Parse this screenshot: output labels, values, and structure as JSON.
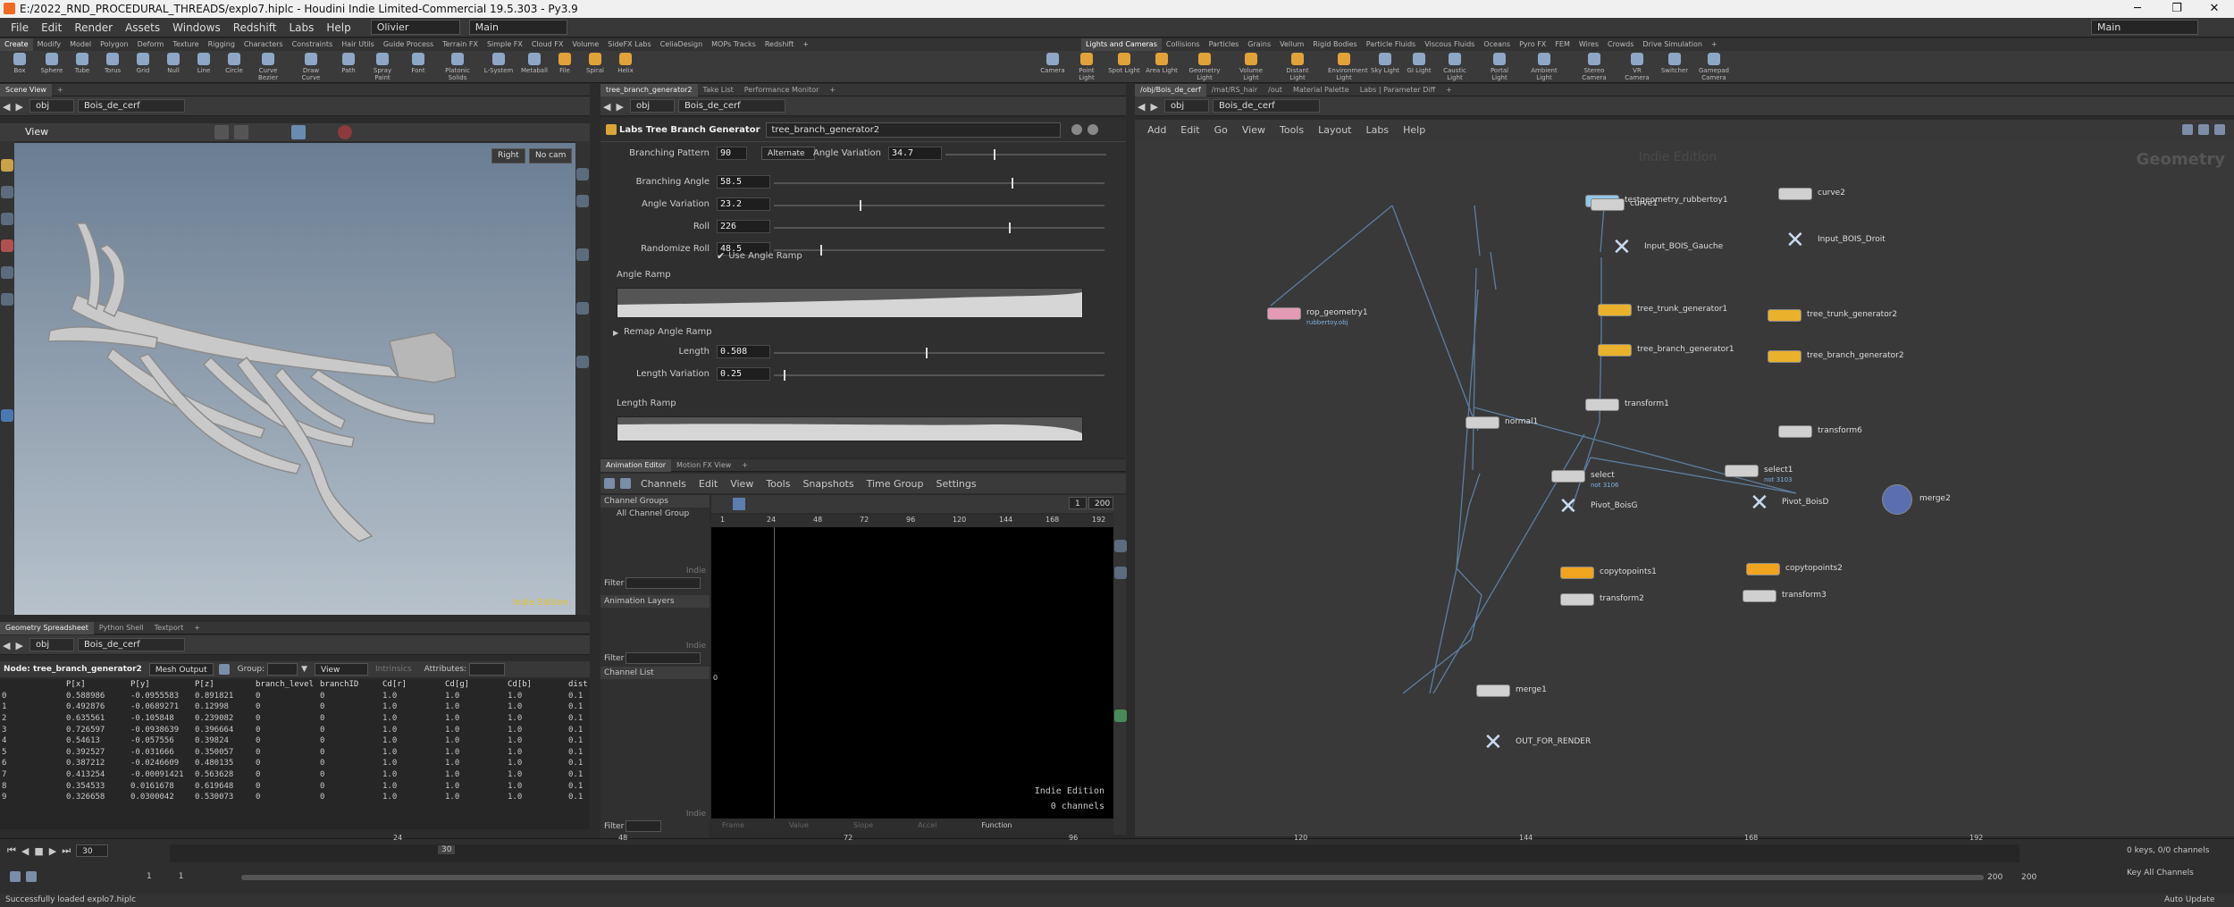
{
  "window": {
    "title": "E:/2022_RND_PROCEDURAL_THREADS/explo7.hiplc - Houdini Indie Limited-Commercial 19.5.303 - Py3.9"
  },
  "menubar": {
    "items": [
      "File",
      "Edit",
      "Render",
      "Assets",
      "Windows",
      "Redshift",
      "Labs",
      "Help"
    ],
    "desktop": "Olivier",
    "main": "Main",
    "right_desktop": "Main"
  },
  "shelf_tabs_left": [
    "Create",
    "Modify",
    "Model",
    "Polygon",
    "Deform",
    "Texture",
    "Rigging",
    "Characters",
    "Constraints",
    "Hair Utils",
    "Guide Process",
    "Terrain FX",
    "Simple FX",
    "Cloud FX",
    "Volume",
    "SideFX Labs",
    "CeliaDesign",
    "MOPs Tracks",
    "Redshift"
  ],
  "shelf_tabs_right": [
    "Lights and Cameras",
    "Collisions",
    "Particles",
    "Grains",
    "Vellum",
    "Rigid Bodies",
    "Particle Fluids",
    "Viscous Fluids",
    "Oceans",
    "Pyro FX",
    "FEM",
    "Wires",
    "Crowds",
    "Drive Simulation"
  ],
  "tools_left": [
    "Box",
    "Sphere",
    "Tube",
    "Torus",
    "Grid",
    "Null",
    "Line",
    "Circle",
    "Curve Bezier",
    "Draw Curve",
    "Path",
    "Spray Paint",
    "Font",
    "Platonic Solids",
    "L-System",
    "Metaball",
    "File",
    "Spiral",
    "Helix"
  ],
  "tools_right": [
    "Camera",
    "Point Light",
    "Spot Light",
    "Area Light",
    "Geometry Light",
    "Volume Light",
    "Distant Light",
    "Environment Light",
    "Sky Light",
    "GI Light",
    "Caustic Light",
    "Portal Light",
    "Ambient Light",
    "Stereo Camera",
    "VR Camera",
    "Switcher",
    "Gamepad Camera"
  ],
  "scene_view": {
    "tab": "Scene View",
    "path_obj": "obj",
    "path_node": "Bois_de_cerf",
    "view_label": "View",
    "cam": "Right",
    "no_cam": "No cam",
    "watermark": "Indie Edition"
  },
  "spreadsheet": {
    "tabs": [
      "Geometry Spreadsheet",
      "Python Shell",
      "Textport"
    ],
    "path_obj": "obj",
    "path_node": "Bois_de_cerf",
    "node_label": "Node: tree_branch_generator2",
    "mode": "Mesh Output",
    "group_label": "Group:",
    "view": "View",
    "intrinsics": "Intrinsics",
    "attributes": "Attributes:",
    "columns": [
      "",
      "P[x]",
      "P[y]",
      "P[z]",
      "branch_level",
      "branchID",
      "Cd[r]",
      "Cd[g]",
      "Cd[b]",
      "dist"
    ],
    "rows": [
      [
        "0",
        "0.588986",
        "-0.0955583",
        "0.891821",
        "0",
        "0",
        "1.0",
        "1.0",
        "1.0",
        "0.1"
      ],
      [
        "1",
        "0.492876",
        "-0.0689271",
        "0.12998",
        "0",
        "0",
        "1.0",
        "1.0",
        "1.0",
        "0.1"
      ],
      [
        "2",
        "0.635561",
        "-0.105848",
        "0.239082",
        "0",
        "0",
        "1.0",
        "1.0",
        "1.0",
        "0.1"
      ],
      [
        "3",
        "0.726597",
        "-0.0938639",
        "0.396664",
        "0",
        "0",
        "1.0",
        "1.0",
        "1.0",
        "0.1"
      ],
      [
        "4",
        "0.54613",
        "-0.057556",
        "0.39824",
        "0",
        "0",
        "1.0",
        "1.0",
        "1.0",
        "0.1"
      ],
      [
        "5",
        "0.392527",
        "-0.031666",
        "0.350057",
        "0",
        "0",
        "1.0",
        "1.0",
        "1.0",
        "0.1"
      ],
      [
        "6",
        "0.387212",
        "-0.0246609",
        "0.480135",
        "0",
        "0",
        "1.0",
        "1.0",
        "1.0",
        "0.1"
      ],
      [
        "7",
        "0.413254",
        "-0.00091421",
        "0.563628",
        "0",
        "0",
        "1.0",
        "1.0",
        "1.0",
        "0.1"
      ],
      [
        "8",
        "0.354533",
        "0.0161678",
        "0.619648",
        "0",
        "0",
        "1.0",
        "1.0",
        "1.0",
        "0.1"
      ],
      [
        "9",
        "0.326658",
        "0.0300042",
        "0.530073",
        "0",
        "0",
        "1.0",
        "1.0",
        "1.0",
        "0.1"
      ]
    ]
  },
  "params": {
    "tabs": [
      "tree_branch_generator2",
      "Take List",
      "Performance Monitor"
    ],
    "path_obj": "obj",
    "path_node": "Bois_de_cerf",
    "node_type": "Labs Tree Branch Generator",
    "node_name": "tree_branch_generator2",
    "branching_pattern_label": "Branching Pattern",
    "branching_pattern": "90",
    "alternate": "Alternate",
    "angle_variation_top_label": "Angle Variation",
    "angle_variation_top": "34.7",
    "fields": [
      {
        "label": "Branching Angle",
        "value": "58.5",
        "pos": 0.72
      },
      {
        "label": "Angle Variation",
        "value": "23.2",
        "pos": 0.26
      },
      {
        "label": "Roll",
        "value": "226",
        "pos": 0.71
      },
      {
        "label": "Randomize Roll",
        "value": "48.5",
        "pos": 0.14
      }
    ],
    "use_angle_ramp": "Use Angle Ramp",
    "angle_ramp": "Angle Ramp",
    "remap_angle_ramp": "Remap Angle Ramp",
    "length_fields": [
      {
        "label": "Length",
        "value": "0.508",
        "pos": 0.46
      },
      {
        "label": "Length Variation",
        "value": "0.25",
        "pos": 0.03
      }
    ],
    "length_ramp": "Length Ramp"
  },
  "anim": {
    "tabs": [
      "Animation Editor",
      "Motion FX View"
    ],
    "menu": [
      "Channels",
      "Edit",
      "View",
      "Tools",
      "Snapshots",
      "Time Group",
      "Settings"
    ],
    "channel_groups": "Channel Groups",
    "all_channel_group": "All Channel Group",
    "animation_layers": "Animation Layers",
    "channel_list": "Channel List",
    "filter": "Filter",
    "indie": "Indie",
    "ruler": [
      "1",
      "24",
      "48",
      "72",
      "96",
      "120",
      "144",
      "168",
      "192"
    ],
    "range_end": "200",
    "frame_field": "1",
    "y_zero": "0",
    "watermark": "Indie Edition",
    "channels": "0 channels",
    "cols": [
      "Frame",
      "Value",
      "Slope",
      "Accel",
      "Function"
    ]
  },
  "network": {
    "tabs": [
      "/obj/Bois_de_cerf",
      "/mat/RS_hair",
      "/out",
      "Material Palette",
      "Labs | Parameter Diff"
    ],
    "path_obj": "obj",
    "path_node": "Bois_de_cerf",
    "menu": [
      "Add",
      "Edit",
      "Go",
      "View",
      "Tools",
      "Layout",
      "Labs",
      "Help"
    ],
    "watermark": "Indie Edition",
    "context": "Geometry",
    "nodes": [
      {
        "n": "testgeometry_rubbertoy1",
        "c": "blue"
      },
      {
        "n": "curve1",
        "c": "grey"
      },
      {
        "n": "curve2",
        "c": "grey"
      },
      {
        "n": "Input_BOIS_Gauche",
        "c": "x"
      },
      {
        "n": "Input_BOIS_Droit",
        "c": "x"
      },
      {
        "n": "rop_geometry1",
        "c": "pink",
        "s": "rubbertoy.obj"
      },
      {
        "n": "tree_trunk_generator1",
        "c": "gold"
      },
      {
        "n": "tree_trunk_generator2",
        "c": "gold"
      },
      {
        "n": "tree_branch_generator1",
        "c": "gold"
      },
      {
        "n": "tree_branch_generator2",
        "c": "gold"
      },
      {
        "n": "transform1",
        "c": "grey"
      },
      {
        "n": "normal1",
        "c": "grey"
      },
      {
        "n": "transform6",
        "c": "grey"
      },
      {
        "n": "select",
        "c": "grey",
        "s": "not 3106"
      },
      {
        "n": "select1",
        "c": "grey",
        "s": "not 3103"
      },
      {
        "n": "merge2",
        "c": "merge"
      },
      {
        "n": "Pivot_BoisG",
        "c": "x"
      },
      {
        "n": "Pivot_BoisD",
        "c": "x"
      },
      {
        "n": "copytopoints1",
        "c": "orange"
      },
      {
        "n": "copytopoints2",
        "c": "orange"
      },
      {
        "n": "transform2",
        "c": "grey"
      },
      {
        "n": "transform3",
        "c": "grey"
      },
      {
        "n": "merge1",
        "c": "grey"
      },
      {
        "n": "OUT_FOR_RENDER",
        "c": "x"
      }
    ]
  },
  "timeline": {
    "frame": "30",
    "fps_field": "30",
    "start": "1",
    "start2": "1",
    "end": "200",
    "end2": "200",
    "ticks": [
      "24",
      "48",
      "72",
      "96",
      "120",
      "144",
      "168",
      "192"
    ],
    "current_tick": "30",
    "keys": "0 keys, 0/0 channels",
    "key_all": "Key All Channels",
    "auto_update": "Auto Update"
  },
  "status": {
    "text": "Successfully loaded explo7.hiplc"
  }
}
